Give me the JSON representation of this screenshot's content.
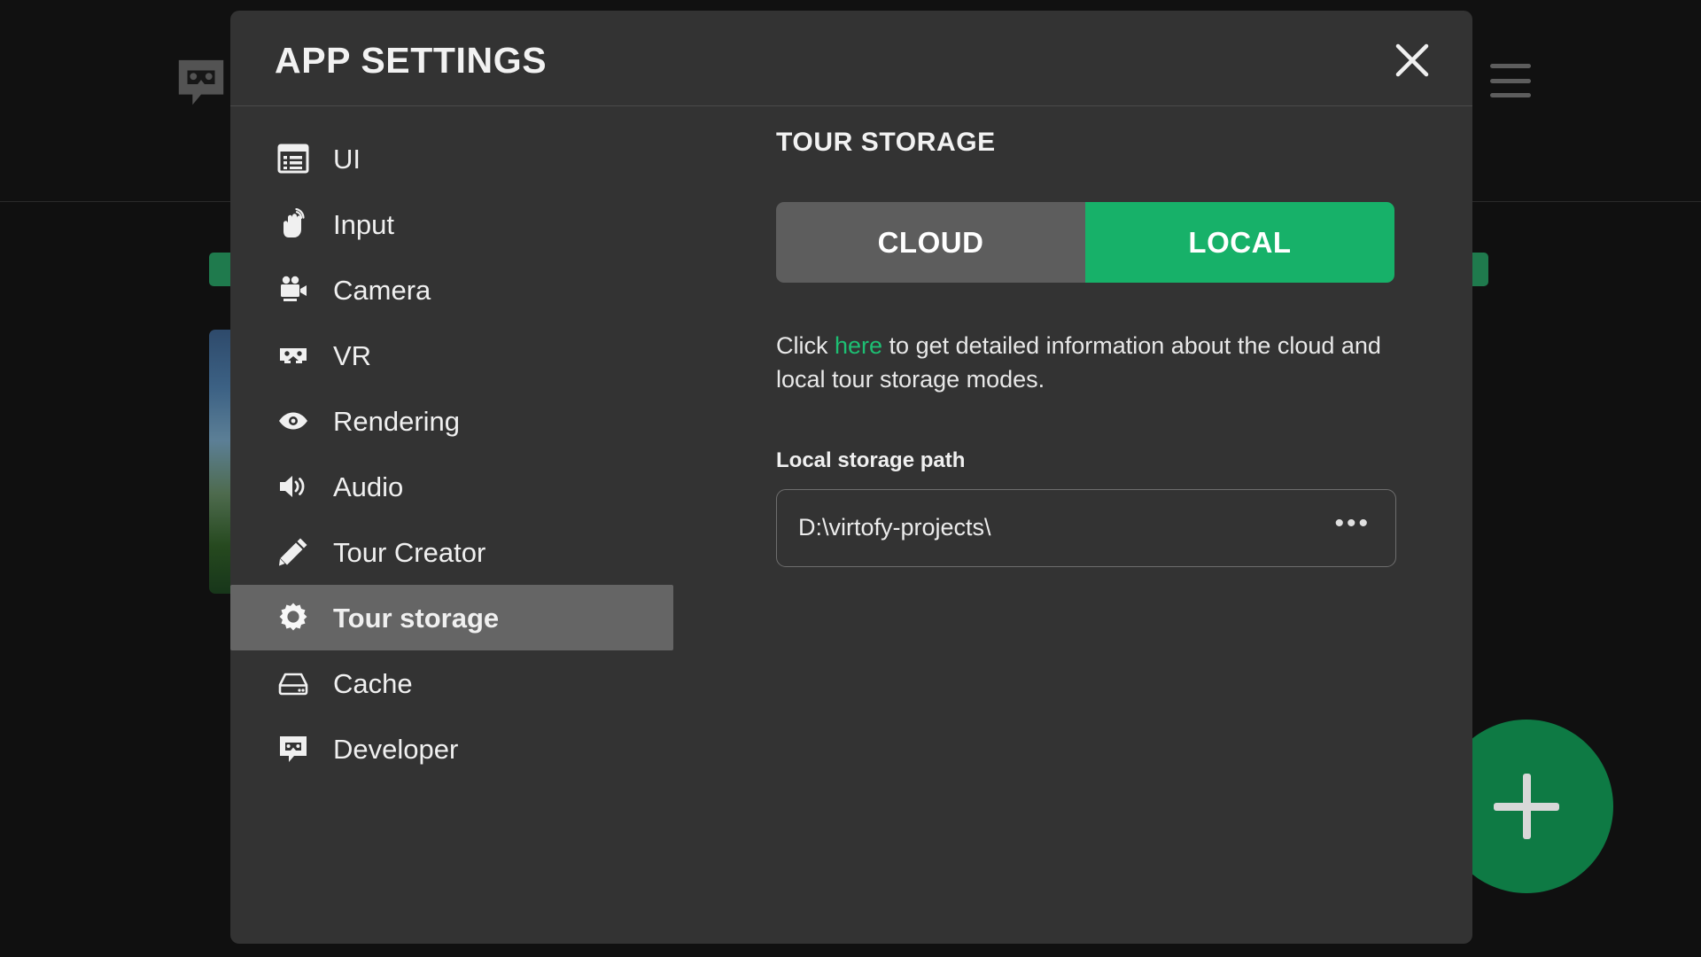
{
  "background": {
    "logo_icon": "vr-speech-bubble-logo-icon",
    "menu_icon": "hamburger-menu-icon",
    "fab_icon": "plus-icon"
  },
  "dialog": {
    "title": "APP SETTINGS",
    "close_icon": "close-icon"
  },
  "sidebar": {
    "items": [
      {
        "label": "UI",
        "icon": "ui-list-window-icon",
        "selected": false
      },
      {
        "label": "Input",
        "icon": "touch-hand-icon",
        "selected": false
      },
      {
        "label": "Camera",
        "icon": "movie-camera-icon",
        "selected": false
      },
      {
        "label": "VR",
        "icon": "vr-goggles-icon",
        "selected": false
      },
      {
        "label": "Rendering",
        "icon": "eye-icon",
        "selected": false
      },
      {
        "label": "Audio",
        "icon": "speaker-volume-icon",
        "selected": false
      },
      {
        "label": "Tour Creator",
        "icon": "pencil-icon",
        "selected": false
      },
      {
        "label": "Tour storage",
        "icon": "gear-icon",
        "selected": true
      },
      {
        "label": "Cache",
        "icon": "hard-drive-icon",
        "selected": false
      },
      {
        "label": "Developer",
        "icon": "vr-speech-bubble-logo-icon",
        "selected": false
      }
    ]
  },
  "content": {
    "heading": "TOUR STORAGE",
    "storage_mode": {
      "options": [
        "CLOUD",
        "LOCAL"
      ],
      "selected": "LOCAL",
      "cloud_label": "CLOUD",
      "local_label": "LOCAL"
    },
    "description": {
      "prefix": "Click ",
      "link": "here",
      "suffix": " to get detailed information about the cloud and local tour storage modes."
    },
    "path_field": {
      "label": "Local storage path",
      "value": "D:\\virtofy-projects\\",
      "browse_label": "•••"
    }
  },
  "colors": {
    "accent_green": "#17b169",
    "link_green": "#1dbf73",
    "dialog_bg": "#333333",
    "selected_nav_bg": "#656565",
    "inactive_toggle_bg": "#5d5d5d"
  }
}
